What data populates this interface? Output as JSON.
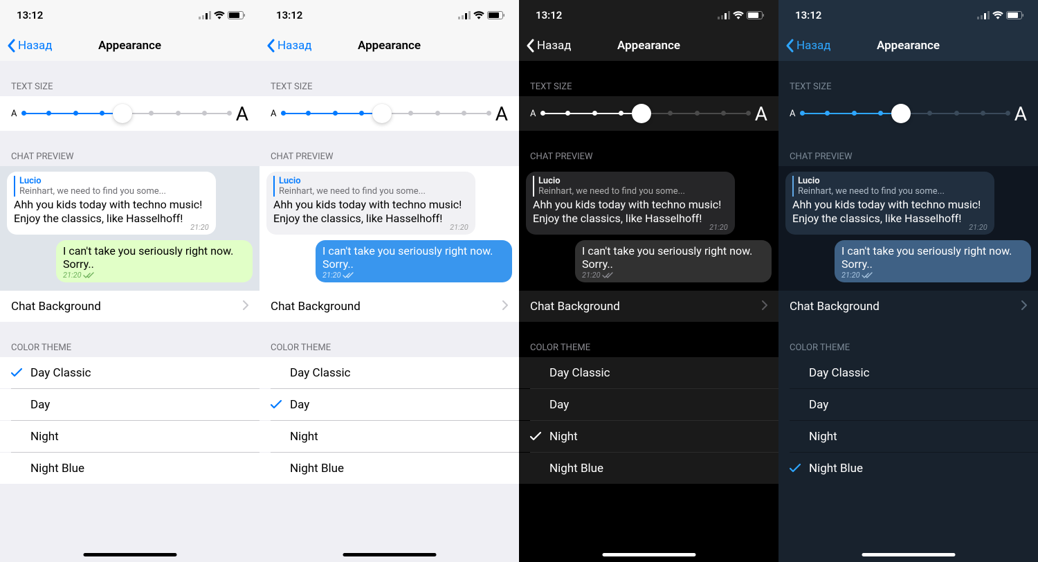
{
  "status": {
    "time": "13:12"
  },
  "nav": {
    "back": "Назад",
    "title": "Appearance"
  },
  "sections": {
    "text_size": "TEXT SIZE",
    "chat_preview": "CHAT PREVIEW",
    "color_theme": "COLOR THEME"
  },
  "slider": {
    "small": "A",
    "big": "A"
  },
  "chat": {
    "reply_name": "Lucio",
    "reply_text": "Reinhart, we need to find you some...",
    "in_text": "Ahh you kids today with techno music! Enjoy the classics, like Hasselhoff!",
    "in_time": "21:20",
    "out_text": "I can't take you seriously right now. Sorry..",
    "out_time": "21:20"
  },
  "rows": {
    "chat_background": "Chat Background"
  },
  "themes": [
    "Day Classic",
    "Day",
    "Night",
    "Night Blue"
  ],
  "selected": [
    0,
    1,
    2,
    3
  ]
}
